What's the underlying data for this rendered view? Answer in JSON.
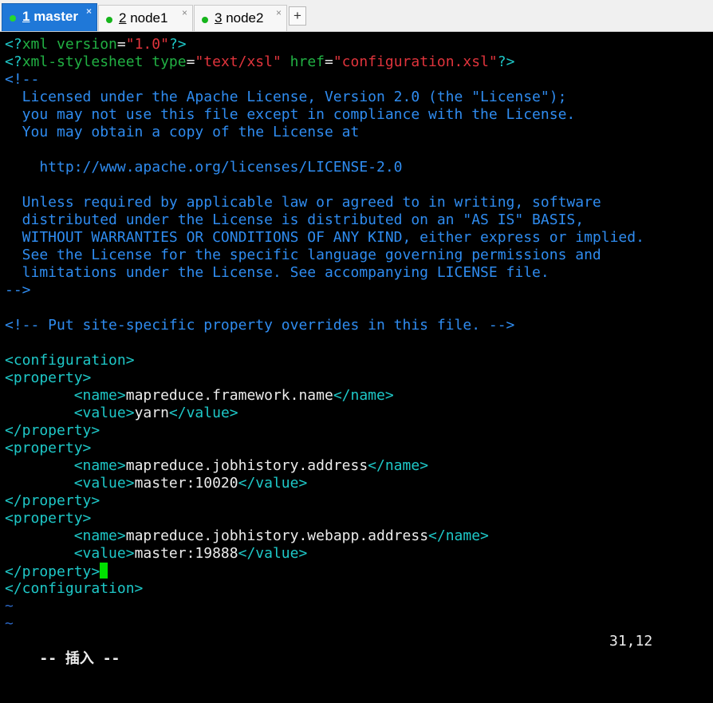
{
  "tabs": [
    {
      "num": "1",
      "name": " master",
      "active": true
    },
    {
      "num": "2",
      "name": " node1",
      "active": false
    },
    {
      "num": "3",
      "name": " node2",
      "active": false
    }
  ],
  "tab_close": "×",
  "new_tab": "+",
  "lines": {
    "l1": {
      "a": "<?",
      "b": "xml version",
      "c": "=",
      "d": "\"1.0\"",
      "e": "?>"
    },
    "l2": {
      "a": "<?",
      "b": "xml-stylesheet type",
      "c": "=",
      "d": "\"text/xsl\"",
      "e": " href",
      "f": "=",
      "g": "\"configuration.xsl\"",
      "h": "?>"
    },
    "l3": "<!--",
    "l4": "  Licensed under the Apache License, Version 2.0 (the \"License\");",
    "l5": "  you may not use this file except in compliance with the License.",
    "l6": "  You may obtain a copy of the License at",
    "l7": "    http://www.apache.org/licenses/LICENSE-2.0",
    "l8": "  Unless required by applicable law or agreed to in writing, software",
    "l9": "  distributed under the License is distributed on an \"AS IS\" BASIS,",
    "l10": "  WITHOUT WARRANTIES OR CONDITIONS OF ANY KIND, either express or implied.",
    "l11": "  See the License for the specific language governing permissions and",
    "l12": "  limitations under the License. See accompanying LICENSE file.",
    "l13": "-->",
    "l14": "<!-- Put site-specific property overrides in this file. -->",
    "l15": "<configuration>",
    "prop_open": "<property>",
    "prop_close": "</property>",
    "name_open": "<name>",
    "name_close": "</name>",
    "value_open": "<value>",
    "value_close": "</value>",
    "indent": "        ",
    "p1_name": "mapreduce.framework.name",
    "p1_value": "yarn",
    "p2_name": "mapreduce.jobhistory.address",
    "p2_value": "master:10020",
    "p3_name": "mapreduce.jobhistory.webapp.address",
    "p3_value": "master:19888",
    "config_close": "</configuration>",
    "tilde": "~"
  },
  "status": {
    "mode": "-- 插入 --",
    "position": "31,12"
  },
  "colors": {
    "comment": "#2f8cf0",
    "tag": "#1ec8c8",
    "string": "#e0343c",
    "attribute": "#21b043",
    "cursor": "#00e000",
    "active_tab": "#1f78d8"
  }
}
